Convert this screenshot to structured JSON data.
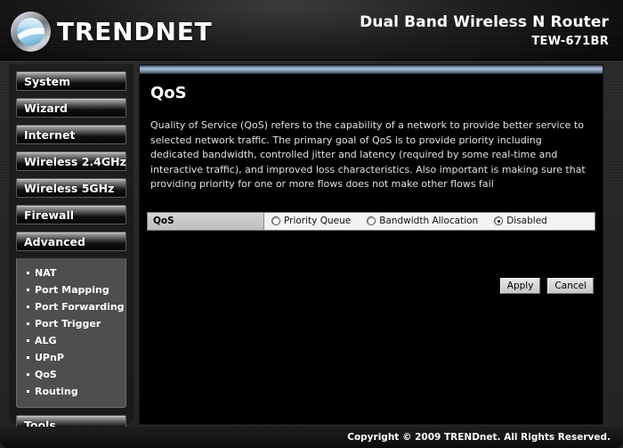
{
  "header": {
    "brand": "TRENDNET",
    "logo_icon": "trendnet-globe-icon",
    "model_title": "Dual Band Wireless N Router",
    "model_number": "TEW-671BR"
  },
  "sidebar": {
    "items": [
      {
        "label": "System"
      },
      {
        "label": "Wizard"
      },
      {
        "label": "Internet"
      },
      {
        "label": "Wireless 2.4GHz"
      },
      {
        "label": "Wireless 5GHz"
      },
      {
        "label": "Firewall"
      },
      {
        "label": "Advanced"
      }
    ],
    "submenu": [
      {
        "label": "NAT"
      },
      {
        "label": "Port Mapping"
      },
      {
        "label": "Port Forwarding"
      },
      {
        "label": "Port Trigger"
      },
      {
        "label": "ALG"
      },
      {
        "label": "UPnP"
      },
      {
        "label": "QoS"
      },
      {
        "label": "Routing"
      }
    ],
    "tools": {
      "label": "Tools"
    }
  },
  "content": {
    "title": "QoS",
    "description": "Quality of Service (QoS) refers to the capability of a network to provide better service to selected network traffic. The primary goal of QoS is to provide priority including dedicated bandwidth, controlled jitter and latency (required by some real-time and interactive traffic), and improved loss characteristics. Also important is making sure that providing priority for one or more flows does not make other flows fail",
    "qos_row": {
      "label": "QoS",
      "options": [
        {
          "label": "Priority Queue",
          "selected": false
        },
        {
          "label": "Bandwidth Allocation",
          "selected": false
        },
        {
          "label": "Disabled",
          "selected": true
        }
      ]
    },
    "buttons": {
      "apply": "Apply",
      "cancel": "Cancel"
    }
  },
  "footer": {
    "copyright": "Copyright © 2009 TRENDnet. All Rights Reserved."
  },
  "colors": {
    "accent_bar": "#aebdd2",
    "content_bg": "#000000",
    "submenu_bg": "#4e4e4e",
    "label_cell": "#c8c8c8"
  }
}
